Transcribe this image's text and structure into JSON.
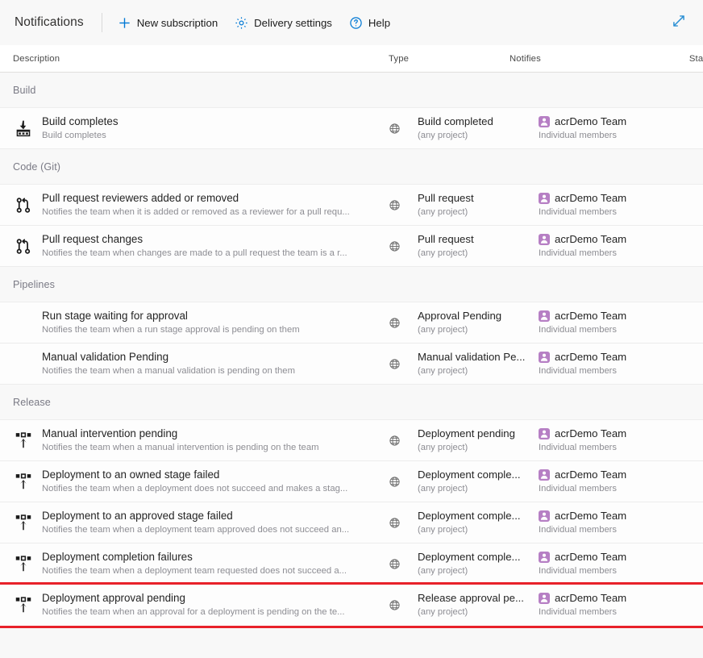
{
  "toolbar": {
    "title": "Notifications",
    "commands": [
      {
        "label": "New subscription",
        "icon": "plus-icon"
      },
      {
        "label": "Delivery settings",
        "icon": "gear-icon"
      },
      {
        "label": "Help",
        "icon": "help-circle-icon"
      }
    ],
    "expand_icon": "expand-diagonal-icon"
  },
  "columns": {
    "description": "Description",
    "type": "Type",
    "notifies": "Notifies",
    "state": "State"
  },
  "colors": {
    "accent": "#0078d4",
    "toggle_on": "#0d7ad4",
    "team_badge": "#b67fc4",
    "highlight": "#e8212a",
    "section_label": "#7a7a85"
  },
  "scope_icon": "globe-icon",
  "sections": [
    {
      "label": "Build",
      "rows": [
        {
          "icon": "build-icon",
          "title": "Build completes",
          "subtitle": "Build completes",
          "scope": "globe-icon",
          "type": "Build completed",
          "type_scope": "(any project)",
          "notifies": "acrDemo Team",
          "notifies_sub": "Individual members",
          "state_on": true,
          "highlighted": false
        }
      ]
    },
    {
      "label": "Code (Git)",
      "rows": [
        {
          "icon": "pull-request-icon",
          "title": "Pull request reviewers added or removed",
          "subtitle": "Notifies the team when it is added or removed as a reviewer for a pull requ...",
          "scope": "globe-icon",
          "type": "Pull request",
          "type_scope": "(any project)",
          "notifies": "acrDemo Team",
          "notifies_sub": "Individual members",
          "state_on": true,
          "highlighted": false
        },
        {
          "icon": "pull-request-icon",
          "title": "Pull request changes",
          "subtitle": "Notifies the team when changes are made to a pull request the team is a r...",
          "scope": "globe-icon",
          "type": "Pull request",
          "type_scope": "(any project)",
          "notifies": "acrDemo Team",
          "notifies_sub": "Individual members",
          "state_on": true,
          "highlighted": false
        }
      ]
    },
    {
      "label": "Pipelines",
      "rows": [
        {
          "icon": "",
          "title": "Run stage waiting for approval",
          "subtitle": "Notifies the team when a run stage approval is pending on them",
          "scope": "globe-icon",
          "type": "Approval Pending",
          "type_scope": "(any project)",
          "notifies": "acrDemo Team",
          "notifies_sub": "Individual members",
          "state_on": true,
          "highlighted": false
        },
        {
          "icon": "",
          "title": "Manual validation Pending",
          "subtitle": "Notifies the team when a manual validation is pending on them",
          "scope": "globe-icon",
          "type": "Manual validation Pe...",
          "type_scope": "(any project)",
          "notifies": "acrDemo Team",
          "notifies_sub": "Individual members",
          "state_on": true,
          "highlighted": false
        }
      ]
    },
    {
      "label": "Release",
      "rows": [
        {
          "icon": "release-icon",
          "title": "Manual intervention pending",
          "subtitle": "Notifies the team when a manual intervention is pending on the team",
          "scope": "globe-icon",
          "type": "Deployment pending",
          "type_scope": "(any project)",
          "notifies": "acrDemo Team",
          "notifies_sub": "Individual members",
          "state_on": true,
          "highlighted": false
        },
        {
          "icon": "release-icon",
          "title": "Deployment to an owned stage failed",
          "subtitle": "Notifies the team when a deployment does not succeed and makes a stag...",
          "scope": "globe-icon",
          "type": "Deployment comple...",
          "type_scope": "(any project)",
          "notifies": "acrDemo Team",
          "notifies_sub": "Individual members",
          "state_on": true,
          "highlighted": false
        },
        {
          "icon": "release-icon",
          "title": "Deployment to an approved stage failed",
          "subtitle": "Notifies the team when a deployment team approved does not succeed an...",
          "scope": "globe-icon",
          "type": "Deployment comple...",
          "type_scope": "(any project)",
          "notifies": "acrDemo Team",
          "notifies_sub": "Individual members",
          "state_on": true,
          "highlighted": false
        },
        {
          "icon": "release-icon",
          "title": "Deployment completion failures",
          "subtitle": "Notifies the team when a deployment team requested does not succeed a...",
          "scope": "globe-icon",
          "type": "Deployment comple...",
          "type_scope": "(any project)",
          "notifies": "acrDemo Team",
          "notifies_sub": "Individual members",
          "state_on": true,
          "highlighted": false
        },
        {
          "icon": "release-icon",
          "title": "Deployment approval pending",
          "subtitle": "Notifies the team when an approval for a deployment is pending on the te...",
          "scope": "globe-icon",
          "type": "Release approval pe...",
          "type_scope": "(any project)",
          "notifies": "acrDemo Team",
          "notifies_sub": "Individual members",
          "state_on": true,
          "highlighted": true
        }
      ]
    }
  ]
}
